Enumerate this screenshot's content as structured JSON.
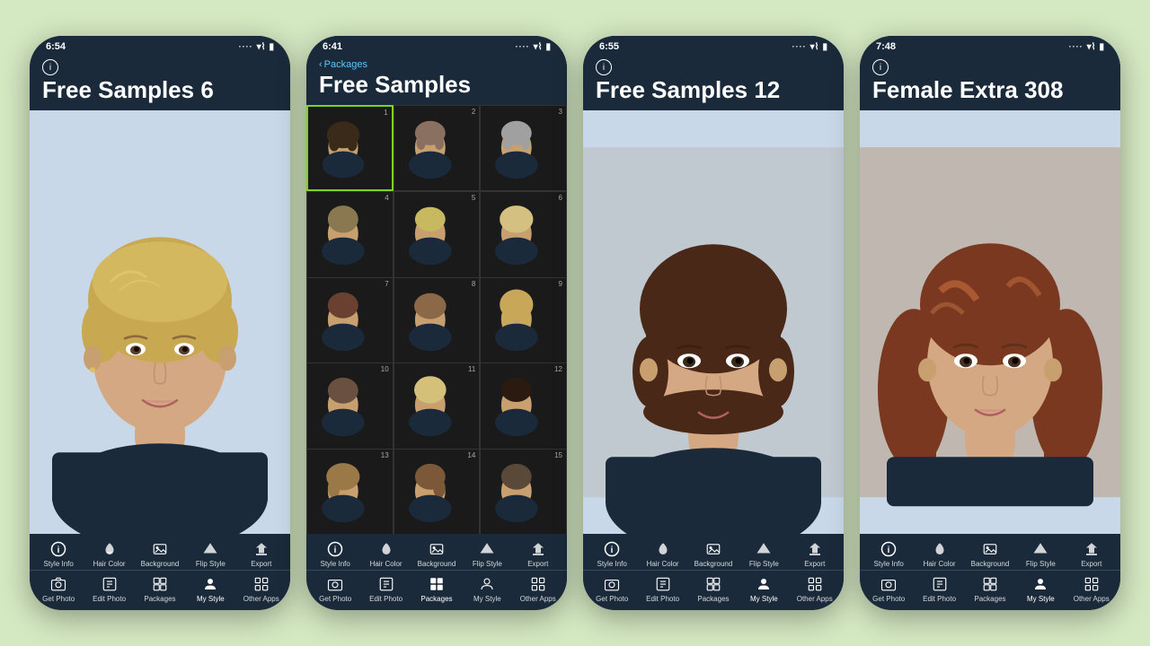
{
  "background": "#d4e8c2",
  "phones": [
    {
      "id": "phone1",
      "status_time": "6:54",
      "title": "Free Samples 6",
      "show_info": true,
      "show_back": false,
      "active_tab_bottom": "my-style",
      "type": "portrait",
      "toolbar_top": [
        "Style Info",
        "Hair Color",
        "Background",
        "Flip Style",
        "Export"
      ],
      "toolbar_bottom": [
        "Get Photo",
        "Edit Photo",
        "Packages",
        "My Style",
        "Other Apps"
      ]
    },
    {
      "id": "phone2",
      "status_time": "6:41",
      "title": "Free Samples",
      "show_info": false,
      "show_back": true,
      "back_label": "Packages",
      "active_tab_bottom": "packages",
      "type": "grid",
      "grid_count": 15,
      "toolbar_top": [
        "Style Info",
        "Hair Color",
        "Background",
        "Flip Style",
        "Export"
      ],
      "toolbar_bottom": [
        "Get Photo",
        "Edit Photo",
        "Packages",
        "My Style",
        "Other Apps"
      ]
    },
    {
      "id": "phone3",
      "status_time": "6:55",
      "title": "Free Samples 12",
      "show_info": true,
      "show_back": false,
      "active_tab_bottom": "my-style",
      "type": "portrait",
      "toolbar_top": [
        "Style Info",
        "Hair Color",
        "Background",
        "Flip Style",
        "Export"
      ],
      "toolbar_bottom": [
        "Get Photo",
        "Edit Photo",
        "Packages",
        "My Style",
        "Other Apps"
      ]
    },
    {
      "id": "phone4",
      "status_time": "7:48",
      "title": "Female Extra 308",
      "show_info": true,
      "show_back": false,
      "active_tab_bottom": "my-style",
      "type": "portrait",
      "toolbar_top": [
        "Style Info",
        "Hair Color",
        "Background",
        "Flip Style",
        "Export"
      ],
      "toolbar_bottom": [
        "Get Photo",
        "Edit Photo",
        "Packages",
        "My Style",
        "Other Apps"
      ]
    }
  ]
}
